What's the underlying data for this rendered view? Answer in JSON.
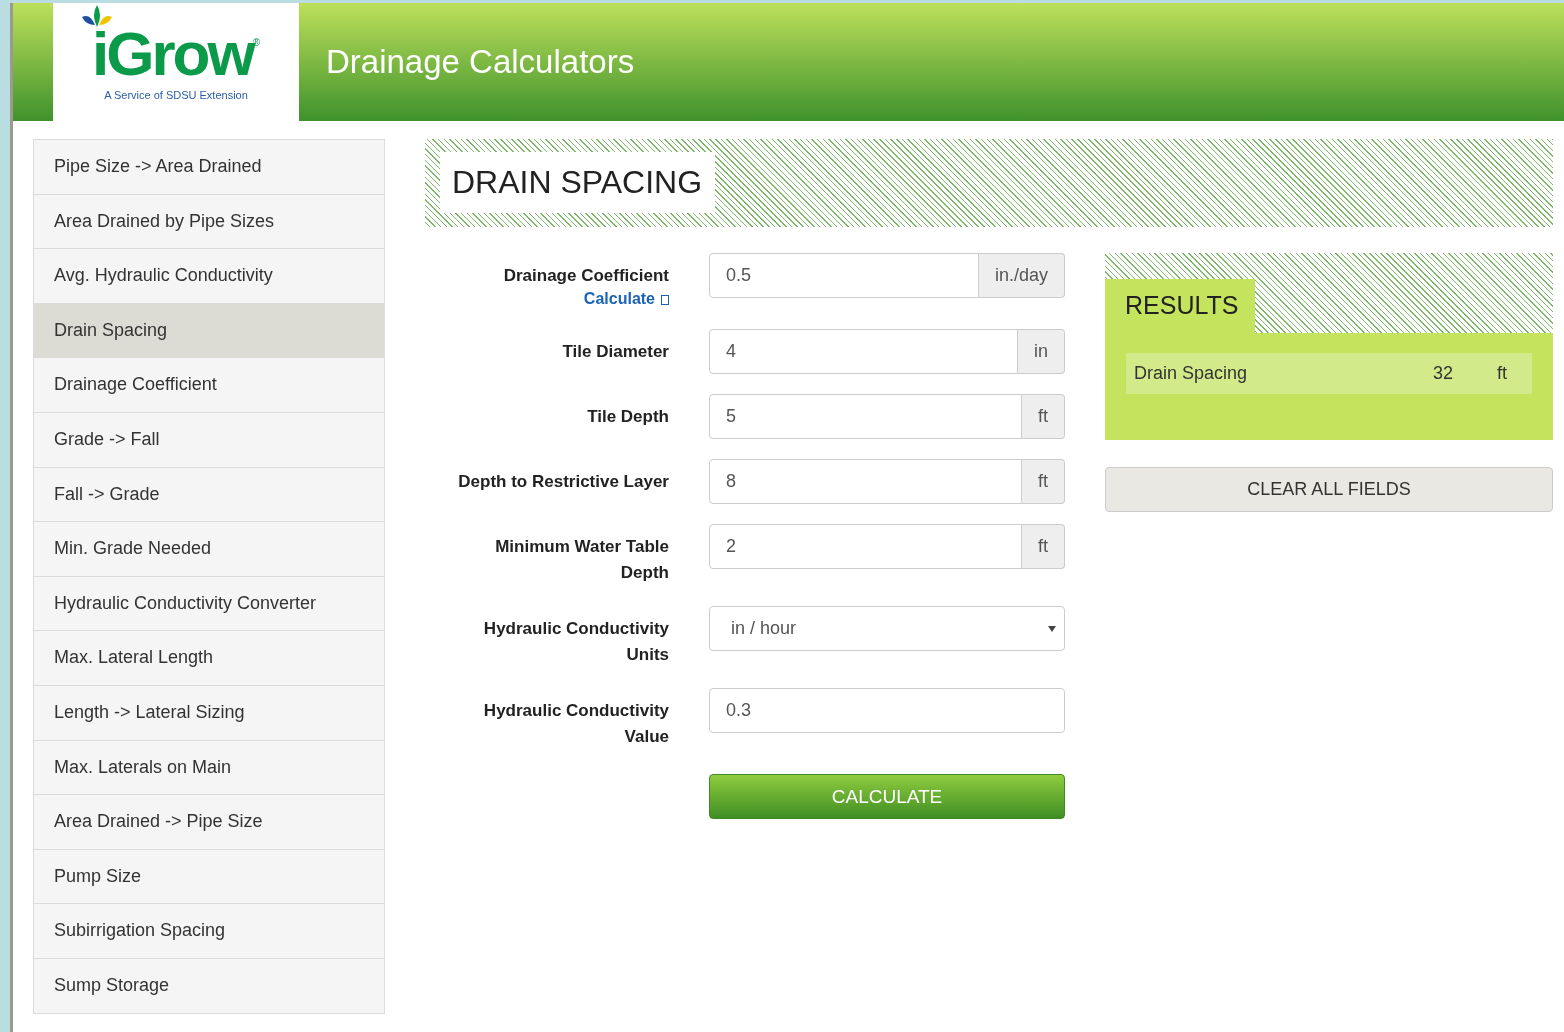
{
  "header": {
    "logo": {
      "name": "iGrow",
      "registered": "®",
      "tagline": "A Service of SDSU Extension"
    },
    "title": "Drainage Calculators"
  },
  "sidebar": {
    "items": [
      {
        "label": "Pipe Size -> Area Drained",
        "selected": false
      },
      {
        "label": "Area Drained by Pipe Sizes",
        "selected": false
      },
      {
        "label": "Avg. Hydraulic Conductivity",
        "selected": false
      },
      {
        "label": "Drain Spacing",
        "selected": true
      },
      {
        "label": "Drainage Coefficient",
        "selected": false
      },
      {
        "label": "Grade -> Fall",
        "selected": false
      },
      {
        "label": "Fall -> Grade",
        "selected": false
      },
      {
        "label": "Min. Grade Needed",
        "selected": false
      },
      {
        "label": "Hydraulic Conductivity Converter",
        "selected": false
      },
      {
        "label": "Max. Lateral Length",
        "selected": false
      },
      {
        "label": "Length -> Lateral Sizing",
        "selected": false
      },
      {
        "label": "Max. Laterals on Main",
        "selected": false
      },
      {
        "label": "Area Drained -> Pipe Size",
        "selected": false
      },
      {
        "label": "Pump Size",
        "selected": false
      },
      {
        "label": "Subirrigation Spacing",
        "selected": false
      },
      {
        "label": "Sump Storage",
        "selected": false
      }
    ]
  },
  "page_title": "DRAIN SPACING",
  "form": {
    "fields": [
      {
        "kind": "input",
        "label": "Drainage Coefficient",
        "link": "Calculate",
        "value": "0.5",
        "unit": "in./day"
      },
      {
        "kind": "input",
        "label": "Tile Diameter",
        "value": "4",
        "unit": "in"
      },
      {
        "kind": "input",
        "label": "Tile Depth",
        "value": "5",
        "unit": "ft"
      },
      {
        "kind": "input",
        "label": "Depth to Restrictive Layer",
        "value": "8",
        "unit": "ft"
      },
      {
        "kind": "input",
        "label": "Minimum Water Table Depth",
        "value": "2",
        "unit": "ft"
      },
      {
        "kind": "select",
        "label": "Hydraulic Conductivity Units",
        "value": "in / hour"
      },
      {
        "kind": "input",
        "label": "Hydraulic Conductivity Value",
        "value": "0.3"
      }
    ],
    "submit": "CALCULATE"
  },
  "results": {
    "title": "RESULTS",
    "rows": [
      {
        "name": "Drain Spacing",
        "value": "32",
        "unit": "ft"
      }
    ]
  },
  "clear_button": "CLEAR ALL FIELDS"
}
